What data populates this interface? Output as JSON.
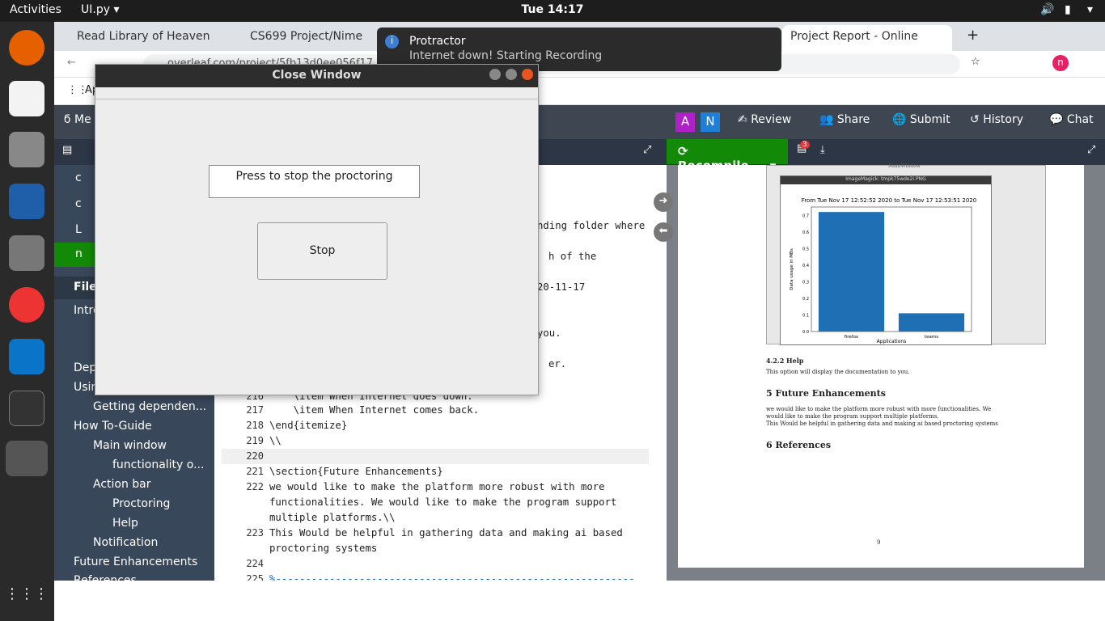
{
  "topbar": {
    "activities": "Activities",
    "app": "UI.py ▾",
    "clock": "Tue 14:17"
  },
  "dock": {
    "items": [
      "firefox-icon",
      "text-editor-icon",
      "files-icon",
      "writer-icon",
      "speaker-icon",
      "chrome-icon",
      "vscode-icon",
      "terminal-icon",
      "app-icon"
    ]
  },
  "tabs": [
    {
      "label": "Read Library of Heaven"
    },
    {
      "label": "CS699 Project/Nime"
    },
    {
      "label": "Project Report - Online"
    }
  ],
  "address": {
    "url": "overleaf.com/project/5fb13d0ee056f17..."
  },
  "bookmarks": {
    "apps": "Ap"
  },
  "overleaf": {
    "menu": "Me",
    "avatars": [
      "A",
      "N"
    ],
    "buttons": [
      "Review",
      "Share",
      "Submit",
      "History",
      "Chat"
    ],
    "recompile": "Recompile",
    "badge": "3"
  },
  "sidebar": {
    "items": [
      {
        "label": "c"
      },
      {
        "label": "c"
      },
      {
        "label": "L"
      },
      {
        "label": "n"
      },
      {
        "label": "File"
      },
      {
        "label": "Intro"
      },
      {
        "label": "Dep"
      },
      {
        "label": "Usin"
      },
      {
        "label": "Getting dependen..."
      },
      {
        "label": "How To-Guide"
      },
      {
        "label": "Main window"
      },
      {
        "label": "functionality o..."
      },
      {
        "label": "Action bar"
      },
      {
        "label": "Proctoring"
      },
      {
        "label": "Help"
      },
      {
        "label": "Notification"
      },
      {
        "label": "Future Enhancements"
      },
      {
        "label": "References"
      }
    ]
  },
  "editor": {
    "partial_lines": [
      "nding folder where",
      "h of the",
      "20-11-17",
      "you.",
      "er."
    ],
    "lines": [
      {
        "num": "216",
        "text": "    \\item When Internet goes down."
      },
      {
        "num": "217",
        "text": "    \\item When Internet comes back."
      },
      {
        "num": "218",
        "text": "\\end{itemize}"
      },
      {
        "num": "219",
        "text": "\\\\"
      },
      {
        "num": "220",
        "text": ""
      },
      {
        "num": "221",
        "text": "\\section{Future Enhancements}"
      },
      {
        "num": "222",
        "text": "we would like to make the platform more robust with more"
      },
      {
        "num": "",
        "text": "functionalities. We would like to make the program support"
      },
      {
        "num": "",
        "text": "multiple platforms.\\\\"
      },
      {
        "num": "223",
        "text": "This Would be helpful in gathering data and making ai based"
      },
      {
        "num": "",
        "text": "proctoring systems"
      },
      {
        "num": "224",
        "text": ""
      },
      {
        "num": "225",
        "text": "%------------------------------------------------------------"
      }
    ]
  },
  "pdf": {
    "figure_window": "MainWindow",
    "figure_title": "ImageMagick: tmpk75wde2i.PNG",
    "chart_title": "From Tue Nov 17 12:52:52 2020 to Tue Nov 17 12:53:51 2020",
    "sec_help": "4.2.2   Help",
    "help_text": "This option will display the documentation to you.",
    "sec_future": "5   Future Enhancements",
    "future_text1": "we would like to make the platform more robust with more functionalities.  We",
    "future_text2": "would like to make the program support multiple platforms.",
    "future_text3": "This Would be helpful in gathering data and making ai based proctoring systems",
    "sec_refs": "6   References",
    "page_num": "9"
  },
  "chart_data": {
    "type": "bar",
    "title": "From Tue Nov 17 12:52:52 2020 to Tue Nov 17 12:53:51 2020",
    "categories": [
      "firefox",
      "teams"
    ],
    "values": [
      0.72,
      0.11
    ],
    "xlabel": "Applications",
    "ylabel": "Data usage in MBs",
    "ylim": [
      0,
      0.75
    ],
    "yticks": [
      "0.0",
      "0.1",
      "0.2",
      "0.3",
      "0.4",
      "0.5",
      "0.6",
      "0.7"
    ],
    "color": "#1f6fb5"
  },
  "notification": {
    "title": "Protractor",
    "message": "Internet down! Starting Recording"
  },
  "dialog": {
    "title": "Close Window",
    "prompt": "Press to stop the proctoring",
    "button": "Stop"
  }
}
